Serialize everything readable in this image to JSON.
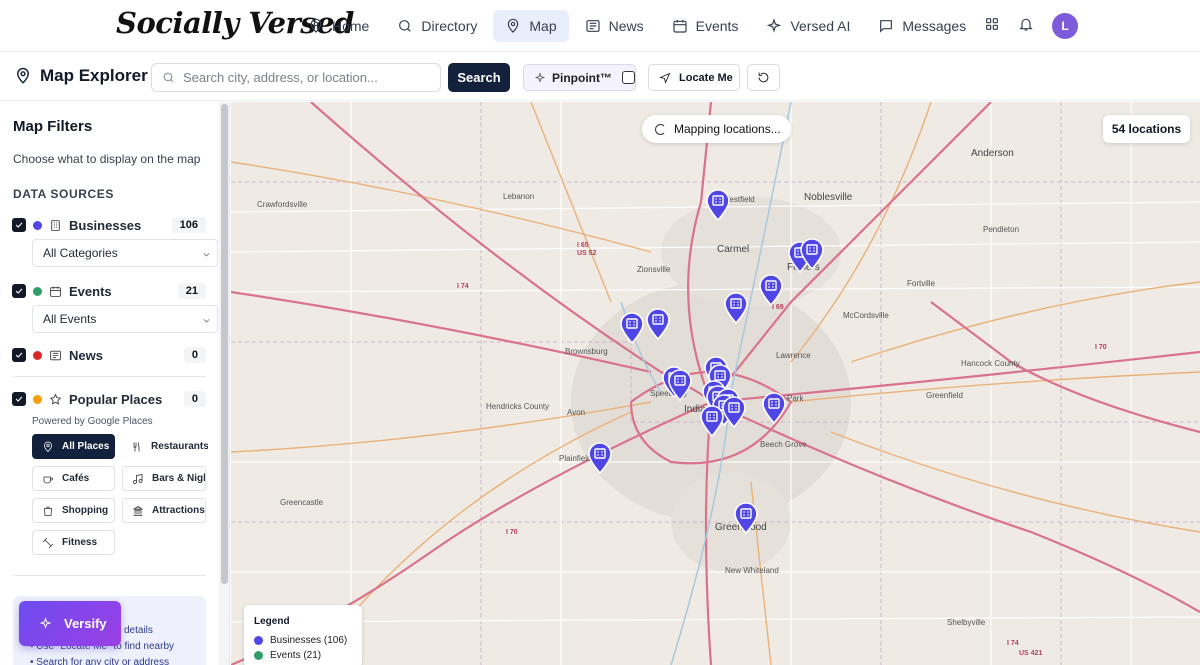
{
  "app": {
    "logo": "Socially Versed",
    "nav": [
      {
        "label": "Home",
        "icon": "pin-icon",
        "active": false
      },
      {
        "label": "Directory",
        "icon": "search-icon",
        "active": false
      },
      {
        "label": "Map",
        "icon": "map-pin-icon",
        "active": true
      },
      {
        "label": "News",
        "icon": "newspaper-icon",
        "active": false
      },
      {
        "label": "Events",
        "icon": "calendar-icon",
        "active": false
      },
      {
        "label": "Versed AI",
        "icon": "sparkles-icon",
        "active": false
      },
      {
        "label": "Messages",
        "icon": "message-icon",
        "active": false
      }
    ],
    "avatar_initial": "L"
  },
  "toolbar": {
    "title": "Map Explorer",
    "search_placeholder": "Search city, address, or location...",
    "search_label": "Search",
    "pinpoint_label": "Pinpoint™",
    "locate_label": "Locate Me"
  },
  "sidebar": {
    "title": "Map Filters",
    "subtitle": "Choose what to display on the map",
    "section": "DATA SOURCES",
    "sources": [
      {
        "label": "Businesses",
        "count": "106",
        "dot_color": "#4f46e5",
        "checked": true
      },
      {
        "label": "Events",
        "count": "21",
        "dot_color": "#2f9e6b",
        "checked": true
      },
      {
        "label": "News",
        "count": "0",
        "dot_color": "#dc2626",
        "checked": true
      },
      {
        "label": "Popular Places",
        "count": "0",
        "dot_color": "#f59e0b",
        "checked": true
      }
    ],
    "business_select": "All Categories",
    "events_select": "All Events",
    "powered_by": "Powered by Google Places",
    "place_chips": [
      {
        "label": "All Places",
        "icon": "pin-icon",
        "active": true
      },
      {
        "label": "Restaurants",
        "icon": "utensils-icon",
        "active": false
      },
      {
        "label": "Cafés",
        "icon": "coffee-icon",
        "active": false
      },
      {
        "label": "Bars & Nightlife",
        "icon": "music-icon",
        "active": false
      },
      {
        "label": "Shopping",
        "icon": "shopping-bag-icon",
        "active": false
      },
      {
        "label": "Attractions",
        "icon": "landmark-icon",
        "active": false
      },
      {
        "label": "Fitness",
        "icon": "dumbbell-icon",
        "active": false
      }
    ],
    "tips": [
      "details",
      "• Use \"Locate Me\" to find nearby",
      "• Search for any city or address"
    ],
    "verisfy_label": "Versify"
  },
  "map": {
    "status": "Mapping locations...",
    "location_count": "54 locations",
    "legend_title": "Legend",
    "legend": [
      {
        "label": "Businesses (106)",
        "color": "#4f46e5"
      },
      {
        "label": "Events (21)",
        "color": "#2f9e6b"
      }
    ],
    "place_labels": [
      "Noblesville",
      "Carmel",
      "Fishers",
      "Anderson",
      "Lebanon",
      "Crawfordsville",
      "Zionsville",
      "Brownsburg",
      "Speedway",
      "Indianapolis",
      "Lawrence",
      "Avon",
      "Plainfield",
      "Beech Grove",
      "Greenwood",
      "Greencastle",
      "Greenfield",
      "New Whiteland",
      "Pendleton",
      "Fortville",
      "McCordsville",
      "Hancock County",
      "Hendricks County",
      "Shelbyville",
      "Westfield",
      "Park"
    ],
    "highway_labels": [
      "I 65",
      "US 52",
      "I 74",
      "I 69",
      "I 70",
      "I 70",
      "I 74",
      "US 421"
    ]
  }
}
